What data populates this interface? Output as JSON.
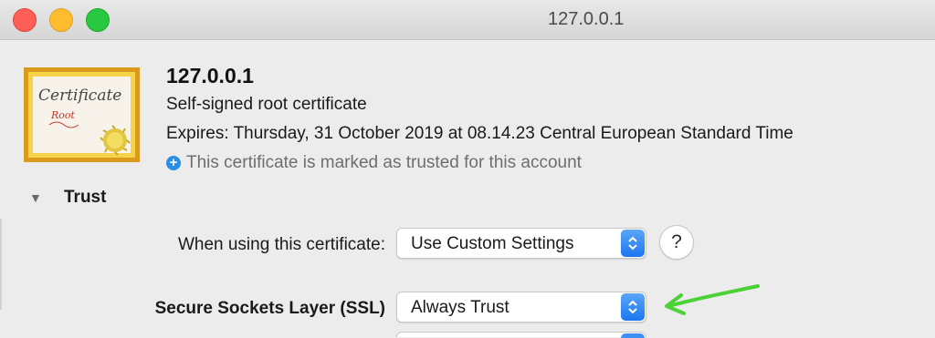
{
  "window": {
    "title": "127.0.0.1"
  },
  "certificate": {
    "name": "127.0.0.1",
    "subtitle": "Self-signed root certificate",
    "expires": "Expires: Thursday, 31 October 2019 at 08.14.23 Central European Standard Time",
    "trusted_note": "This certificate is marked as trusted for this account",
    "icon_text_main": "Certificate",
    "icon_text_sub": "Root"
  },
  "trust": {
    "section_label": "Trust",
    "when_using_label": "When using this certificate:",
    "when_using_value": "Use Custom Settings",
    "help_label": "?",
    "ssl_label": "Secure Sockets Layer (SSL)",
    "ssl_value": "Always Trust"
  },
  "colors": {
    "accent": "#1c77ef",
    "annotation_arrow": "#4cd137"
  },
  "icons": [
    "close-icon",
    "minimize-icon",
    "zoom-icon",
    "certificate-icon",
    "plus-info-icon",
    "disclosure-triangle-icon",
    "popup-stepper-icon",
    "help-icon",
    "annotation-arrow-icon"
  ]
}
